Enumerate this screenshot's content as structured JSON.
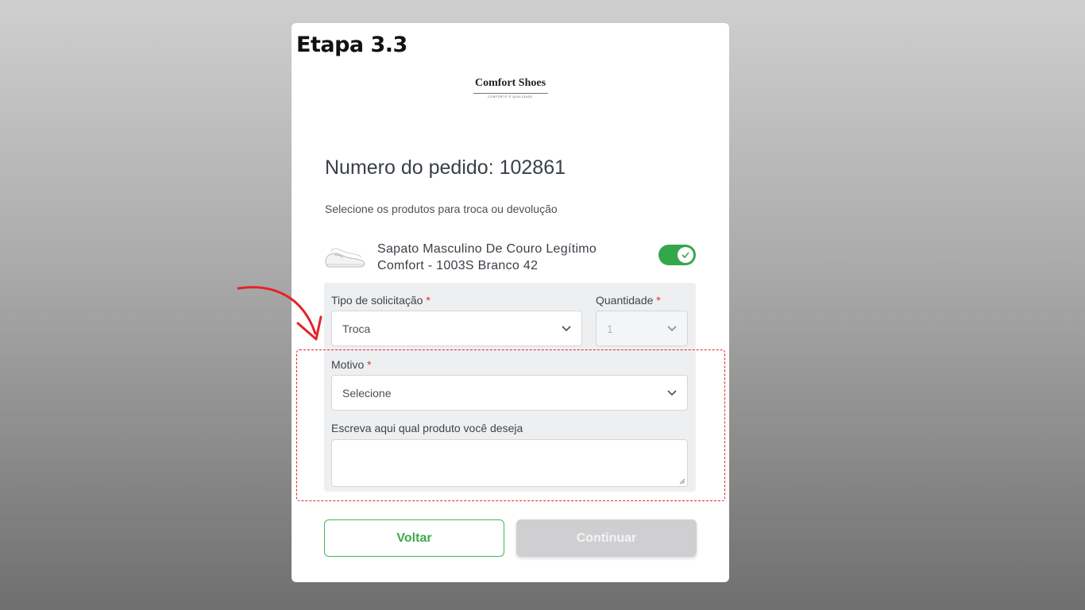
{
  "step_title": "Etapa 3.3",
  "logo": {
    "name": "Comfort Shoes",
    "tagline": "CONFORTO E QUALIDADE"
  },
  "order": {
    "title": "Numero do pedido: 102861"
  },
  "subtitle": "Selecione os produtos para troca ou devolução",
  "product": {
    "name": "Sapato Masculino De Couro Legítimo Comfort - 1003S Branco 42",
    "selected": true
  },
  "form": {
    "request_type": {
      "label": "Tipo de solicitação",
      "required_mark": "*",
      "value": "Troca"
    },
    "quantity": {
      "label": "Quantidade",
      "required_mark": "*",
      "value": "1"
    },
    "reason": {
      "label": "Motivo",
      "required_mark": "*",
      "value": "Selecione"
    },
    "desired_product": {
      "label": "Escreva aqui qual produto você deseja",
      "value": ""
    }
  },
  "buttons": {
    "back": "Voltar",
    "continue": "Continuar"
  },
  "colors": {
    "accent_green": "#35a74b",
    "annotation_red": "#e3242b",
    "disabled_button": "#cfcfd1"
  }
}
